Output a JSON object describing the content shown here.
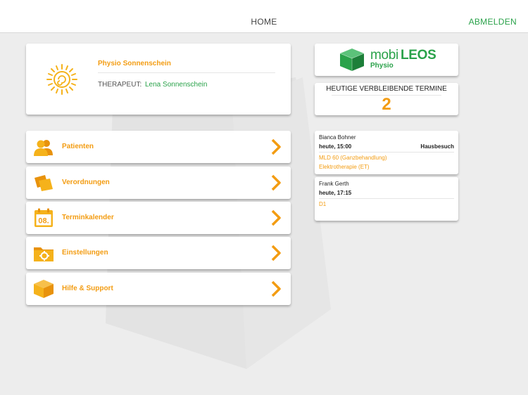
{
  "header": {
    "title": "HOME",
    "logout_label": "ABMELDEN"
  },
  "practice": {
    "name": "Physio Sonnenschein",
    "therapist_label": "THERAPEUT:",
    "therapist_name": "Lena Sonnenschein"
  },
  "menu": {
    "items": [
      {
        "label": "Patienten",
        "icon": "patients-icon"
      },
      {
        "label": "Verordnungen",
        "icon": "prescriptions-icon"
      },
      {
        "label": "Terminkalender",
        "icon": "calendar-icon",
        "calendar_day": "08."
      },
      {
        "label": "Einstellungen",
        "icon": "settings-folder-icon"
      },
      {
        "label": "Hilfe & Support",
        "icon": "help-cube-icon"
      }
    ]
  },
  "brand": {
    "logo_light": "mobi",
    "logo_bold": "LEOS",
    "logo_sub": "Physio"
  },
  "today": {
    "label": "HEUTIGE VERBLEIBENDE TERMINE",
    "remaining": "2"
  },
  "appointments": [
    {
      "patient": "Bianca Bohner",
      "time": "heute, 15:00",
      "badge": "Hausbesuch",
      "treatments": [
        "MLD 60 (Ganzbehandlung)",
        "Elektrotherapie (ET)"
      ]
    },
    {
      "patient": "Frank Gerth",
      "time": "heute, 17:15",
      "badge": "",
      "treatments": [
        "D1"
      ]
    }
  ],
  "colors": {
    "accent_orange": "#f39c12",
    "brand_green": "#2aa24a",
    "background": "#ededed"
  }
}
